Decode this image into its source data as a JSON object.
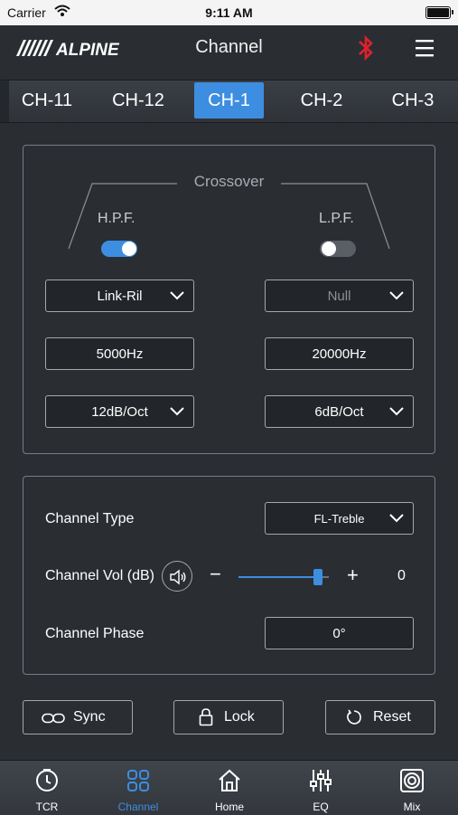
{
  "status": {
    "carrier": "Carrier",
    "time": "9:11 AM"
  },
  "header": {
    "title": "Channel",
    "logo_text": "ALPINE"
  },
  "tabs": [
    {
      "label": "CH-11"
    },
    {
      "label": "CH-12"
    },
    {
      "label": "CH-1",
      "active": true
    },
    {
      "label": "CH-2"
    },
    {
      "label": "CH-3"
    }
  ],
  "crossover": {
    "title": "Crossover",
    "hpf": {
      "label": "H.P.F.",
      "enabled": true,
      "type": "Link-Ril",
      "freq": "5000Hz",
      "slope": "12dB/Oct"
    },
    "lpf": {
      "label": "L.P.F.",
      "enabled": false,
      "type": "Null",
      "freq": "20000Hz",
      "slope": "6dB/Oct"
    }
  },
  "channel": {
    "type_label": "Channel Type",
    "type_value": "FL-Treble",
    "vol_label": "Channel Vol (dB)",
    "vol_minus": "−",
    "vol_plus": "+",
    "vol_value": "0",
    "vol_level": 0.88,
    "phase_label": "Channel Phase",
    "phase_value": "0°"
  },
  "actions": {
    "sync": "Sync",
    "lock": "Lock",
    "reset": "Reset"
  },
  "bottom_nav": [
    {
      "label": "TCR",
      "icon": "clock-icon"
    },
    {
      "label": "Channel",
      "icon": "grid-icon",
      "active": true
    },
    {
      "label": "Home",
      "icon": "home-icon"
    },
    {
      "label": "EQ",
      "icon": "equalizer-icon"
    },
    {
      "label": "Mix",
      "icon": "speaker-icon"
    }
  ],
  "colors": {
    "accent": "#3d8ee0",
    "background": "#2a2e33",
    "bluetooth": "#e0202a"
  }
}
